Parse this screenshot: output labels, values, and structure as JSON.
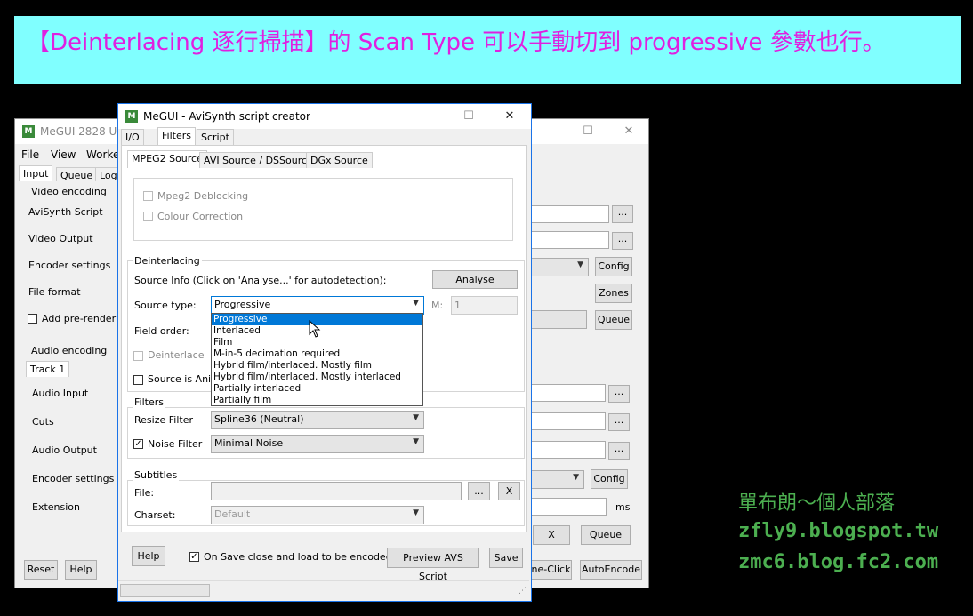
{
  "banner": {
    "text": "【Deinterlacing 逐行掃描】的 Scan Type 可以手動切到 progressive 參數也行。"
  },
  "back_window": {
    "title": "MeGUI 2828 UP",
    "menu": [
      "File",
      "View",
      "Worke"
    ],
    "tabs": [
      "Input",
      "Queue",
      "Log"
    ],
    "video_group": "Video encoding",
    "video_labels": [
      "AviSynth Script",
      "Video Output",
      "Encoder settings",
      "File format"
    ],
    "add_prerender": "Add pre-renderin",
    "audio_group": "Audio encoding",
    "track_tab": "Track 1",
    "audio_labels": [
      "Audio Input",
      "Cuts",
      "Audio Output",
      "Encoder settings",
      "Extension"
    ],
    "config": "Config",
    "zones": "Zones",
    "queue": "Queue",
    "ellipsis": "...",
    "x": "X",
    "ms": "ms",
    "reset": "Reset",
    "help": "Help",
    "oneclick": "ne-Click",
    "autoencode": "AutoEncode"
  },
  "dialog": {
    "title": "MeGUI - AviSynth script creator",
    "app_icon": "M",
    "tabs": [
      "I/O",
      "Filters",
      "Script"
    ],
    "subtabs": [
      "MPEG2 Source",
      "AVI Source / DSSource",
      "DGx Source"
    ],
    "mpeg2_deblocking": "Mpeg2 Deblocking",
    "colour_correction": "Colour Correction",
    "deinterlacing_group": "Deinterlacing",
    "source_info": "Source Info (Click on 'Analyse...' for autodetection):",
    "analyse": "Analyse",
    "source_type_label": "Source type:",
    "source_type_value": "Progressive",
    "m_label": "M:",
    "m_value": "1",
    "field_order_label": "Field order:",
    "deinterlace": "Deinterlace",
    "source_is_anim": "Source is Anim",
    "dropdown_options": [
      "Progressive",
      "Interlaced",
      "Film",
      "M-in-5 decimation required",
      "Hybrid film/interlaced. Mostly film",
      "Hybrid film/interlaced. Mostly interlaced",
      "Partially interlaced",
      "Partially film"
    ],
    "filters_group": "Filters",
    "resize_label": "Resize Filter",
    "resize_value": "Spline36 (Neutral)",
    "noise_label": "Noise Filter",
    "noise_value": "Minimal Noise",
    "subtitles_group": "Subtitles",
    "file_label": "File:",
    "charset_label": "Charset:",
    "charset_value": "Default",
    "ellipsis": "...",
    "x": "X",
    "help": "Help",
    "on_save": "On Save close and load to be encoded",
    "preview": "Preview AVS Script",
    "save": "Save",
    "caption_minimize": "—",
    "caption_maximize": "☐",
    "caption_close": "✕"
  },
  "watermark": [
    "單布朗～個人部落",
    "zfly9.blogspot.tw",
    "zmc6.blog.fc2.com"
  ]
}
